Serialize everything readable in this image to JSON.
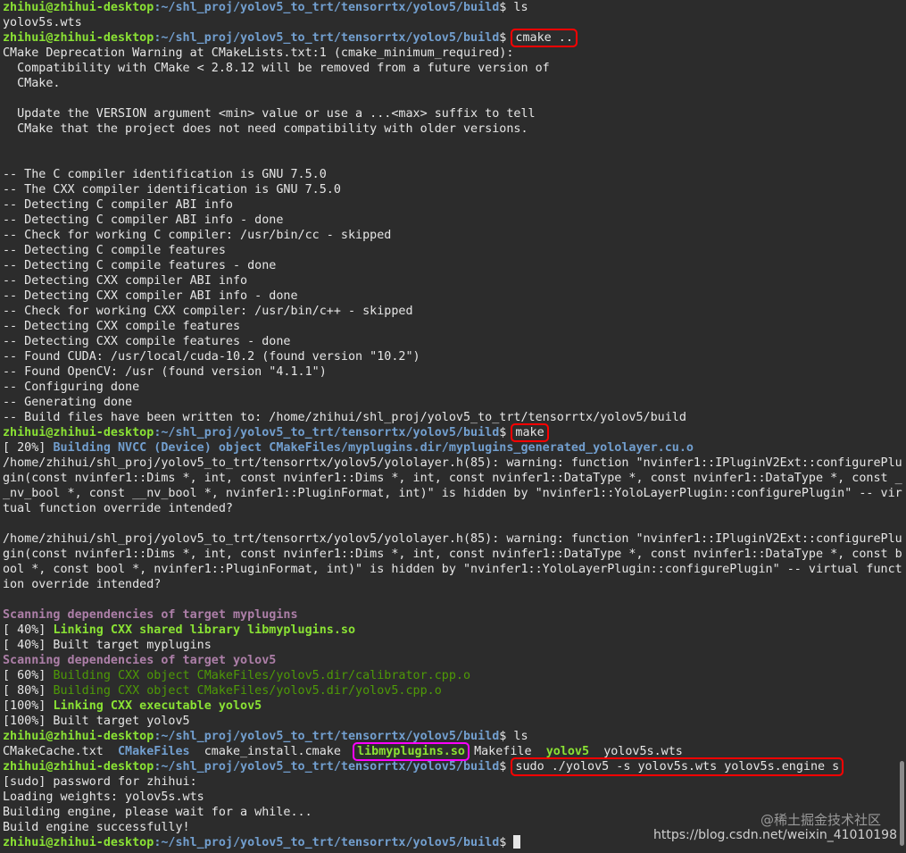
{
  "prompt": {
    "user": "zhihui@zhihui-desktop",
    "path": ":~/shl_proj/yolov5_to_trt/tensorrtx/yolov5/build",
    "symbol": "$ "
  },
  "commands": {
    "ls": "ls",
    "cmake": "cmake ..",
    "make": "make",
    "sudo": "sudo ./yolov5 -s yolov5s.wts yolov5s.engine s"
  },
  "ls1_output": "yolov5s.wts",
  "cmake_output": [
    "CMake Deprecation Warning at CMakeLists.txt:1 (cmake_minimum_required):",
    "  Compatibility with CMake < 2.8.12 will be removed from a future version of",
    "  CMake.",
    "",
    "  Update the VERSION argument <min> value or use a ...<max> suffix to tell",
    "  CMake that the project does not need compatibility with older versions.",
    "",
    "",
    "-- The C compiler identification is GNU 7.5.0",
    "-- The CXX compiler identification is GNU 7.5.0",
    "-- Detecting C compiler ABI info",
    "-- Detecting C compiler ABI info - done",
    "-- Check for working C compiler: /usr/bin/cc - skipped",
    "-- Detecting C compile features",
    "-- Detecting C compile features - done",
    "-- Detecting CXX compiler ABI info",
    "-- Detecting CXX compiler ABI info - done",
    "-- Check for working CXX compiler: /usr/bin/c++ - skipped",
    "-- Detecting CXX compile features",
    "-- Detecting CXX compile features - done",
    "-- Found CUDA: /usr/local/cuda-10.2 (found version \"10.2\")",
    "-- Found OpenCV: /usr (found version \"4.1.1\")",
    "-- Configuring done",
    "-- Generating done",
    "-- Build files have been written to: /home/zhihui/shl_proj/yolov5_to_trt/tensorrtx/yolov5/build"
  ],
  "make_output": {
    "nvcc_prefix": "[ 20%] ",
    "nvcc_text": "Building NVCC (Device) object CMakeFiles/myplugins.dir/myplugins_generated_yololayer.cu.o",
    "warning1": [
      "/home/zhihui/shl_proj/yolov5_to_trt/tensorrtx/yolov5/yololayer.h(85): warning: function \"nvinfer1::IPluginV2Ext::configurePlu",
      "gin(const nvinfer1::Dims *, int, const nvinfer1::Dims *, int, const nvinfer1::DataType *, const nvinfer1::DataType *, const _",
      "_nv_bool *, const __nv_bool *, nvinfer1::PluginFormat, int)\" is hidden by \"nvinfer1::YoloLayerPlugin::configurePlugin\" -- vir",
      "tual function override intended?"
    ],
    "warning2": [
      "/home/zhihui/shl_proj/yolov5_to_trt/tensorrtx/yolov5/yololayer.h(85): warning: function \"nvinfer1::IPluginV2Ext::configurePlu",
      "gin(const nvinfer1::Dims *, int, const nvinfer1::Dims *, int, const nvinfer1::DataType *, const nvinfer1::DataType *, const b",
      "ool *, const bool *, nvinfer1::PluginFormat, int)\" is hidden by \"nvinfer1::YoloLayerPlugin::configurePlugin\" -- virtual funct",
      "ion override intended?"
    ],
    "scan1": "Scanning dependencies of target myplugins",
    "link1_prefix": "[ 40%] ",
    "link1_text": "Linking CXX shared library libmyplugins.so",
    "built1": "[ 40%] Built target myplugins",
    "scan2": "Scanning dependencies of target yolov5",
    "obj1_prefix": "[ 60%] ",
    "obj1_text": "Building CXX object CMakeFiles/yolov5.dir/calibrator.cpp.o",
    "obj2_prefix": "[ 80%] ",
    "obj2_text": "Building CXX object CMakeFiles/yolov5.dir/yolov5.cpp.o",
    "link2_prefix": "[100%] ",
    "link2_text": "Linking CXX executable yolov5",
    "built2": "[100%] Built target yolov5"
  },
  "ls2_output": {
    "f1": "CMakeCache.txt",
    "f2": "CMakeFiles",
    "f3": "cmake_install.cmake",
    "f4": "libmyplugins.so",
    "f5": "Makefile",
    "f6": "yolov5",
    "f7": "yolov5s.wts"
  },
  "sudo_output": [
    "[sudo] password for zhihui:",
    "Loading weights: yolov5s.wts",
    "Building engine, please wait for a while...",
    "Build engine successfully!"
  ],
  "watermark": {
    "top": "@稀土掘金技术社区",
    "url": "https://blog.csdn.net/weixin_41010198"
  },
  "colors": {
    "background": "#2c2c2c",
    "prompt_user": "#8ae234",
    "prompt_path": "#729fcf",
    "highlight_red": "#ff0000",
    "highlight_magenta": "#ff00ff"
  }
}
